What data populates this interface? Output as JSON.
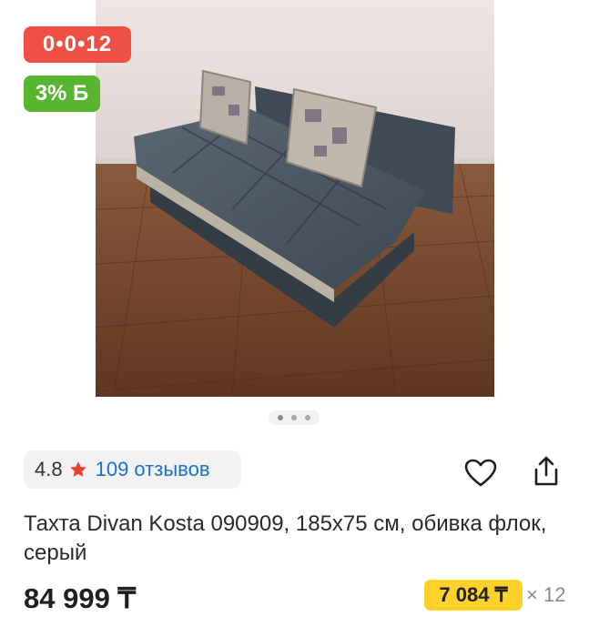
{
  "badges": {
    "installment": "0•0•12",
    "bonus": "3% Б"
  },
  "gallery": {
    "image_subject": "sofa-photo",
    "total_images": 3,
    "active_index": 0
  },
  "rating": {
    "value": "4.8",
    "reviews": "109 отзывов",
    "star_color": "#e8412f"
  },
  "product": {
    "title": "Тахта Divan Kosta 090909, 185x75 см, обивка флок, серый",
    "price": "84 999 ₸",
    "monthly_payment": "7 084 ₸",
    "installment_term": "× 12"
  },
  "icons": {
    "favorite": "heart-icon",
    "share": "share-icon"
  },
  "colors": {
    "installment_badge": "#f04f45",
    "bonus_badge": "#57b52f",
    "monthly_highlight": "#ffd12b",
    "link": "#1a73c8"
  }
}
